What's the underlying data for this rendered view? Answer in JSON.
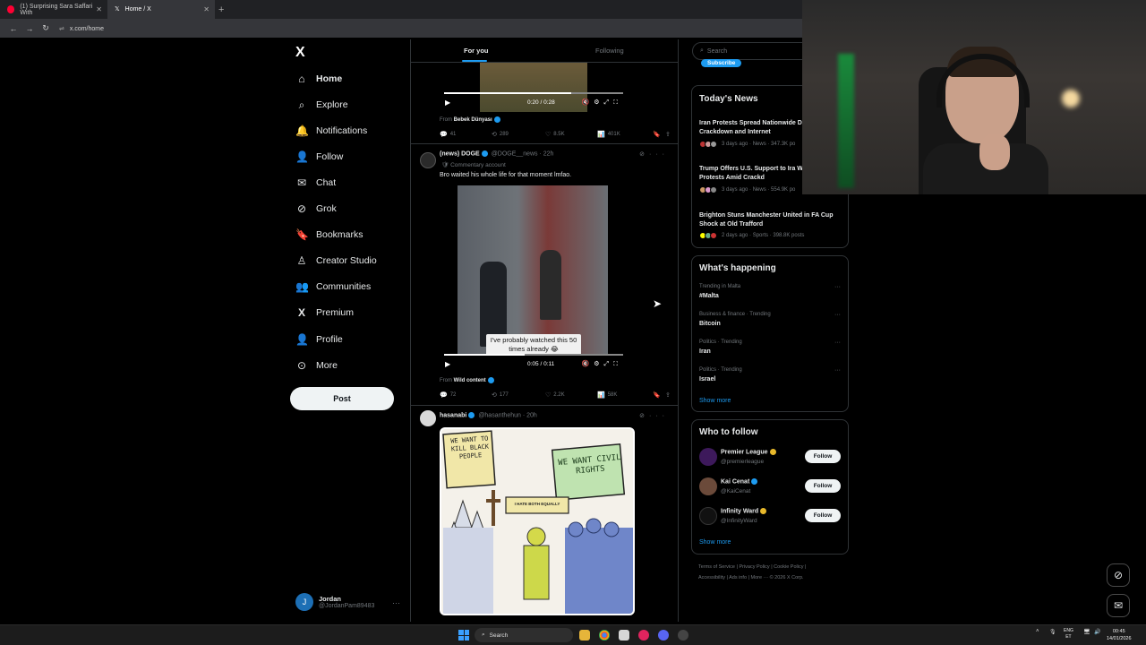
{
  "browser": {
    "tabs": [
      {
        "label": "(1) Surprising Sara Saffari With",
        "favicon_color": "#ff0033"
      },
      {
        "label": "Home / X",
        "favicon_color": "#ffffff"
      }
    ],
    "url": "x.com/home"
  },
  "nav": {
    "logo": "X",
    "items": [
      {
        "label": "Home",
        "icon": "⌂",
        "name": "home"
      },
      {
        "label": "Explore",
        "icon": "⌕",
        "name": "explore"
      },
      {
        "label": "Notifications",
        "icon": "🔔",
        "name": "notifications"
      },
      {
        "label": "Follow",
        "icon": "👤",
        "name": "follow"
      },
      {
        "label": "Chat",
        "icon": "✉",
        "name": "chat"
      },
      {
        "label": "Grok",
        "icon": "⊘",
        "name": "grok"
      },
      {
        "label": "Bookmarks",
        "icon": "🔖",
        "name": "bookmarks"
      },
      {
        "label": "Creator Studio",
        "icon": "♙",
        "name": "creator-studio"
      },
      {
        "label": "Communities",
        "icon": "👥",
        "name": "communities"
      },
      {
        "label": "Premium",
        "icon": "X",
        "name": "premium"
      },
      {
        "label": "Profile",
        "icon": "👤",
        "name": "profile"
      },
      {
        "label": "More",
        "icon": "⊙",
        "name": "more"
      }
    ],
    "post_label": "Post",
    "account": {
      "initial": "J",
      "name": "Jordan",
      "handle": "@JordanPam89483"
    }
  },
  "feed": {
    "tabs": {
      "for_you": "For you",
      "following": "Following"
    },
    "post1": {
      "time": "0:20 / 0:28",
      "progress": 0.71,
      "from_label": "From",
      "from_name": "Bebek Dünyası",
      "replies": "41",
      "reposts": "289",
      "likes": "8.5K",
      "views": "401K"
    },
    "post2": {
      "name": "(news) DOGE",
      "handle": "@DOGE__news · 22h",
      "commentary": "Commentary account",
      "text": "Bro waited his whole life for that moment lmfao.",
      "caption": "I've probably watched this 50 times already 😂",
      "time": "0:05 / 0:11",
      "progress": 0.45,
      "from_label": "From",
      "from_name": "Wild content",
      "replies": "72",
      "reposts": "177",
      "likes": "2.2K",
      "views": "58K"
    },
    "post3": {
      "name": "hasanabi",
      "handle": "@hasanthehun · 20h",
      "sign_left": "WE WANT TO KILL BLACK PEOPLE",
      "sign_right": "WE WANT CIVIL RIGHTS",
      "sign_center": "I HATE BOTH EQUALLY"
    }
  },
  "right": {
    "search_placeholder": "Search",
    "subscribe": "Subscribe",
    "news": {
      "title": "Today's News",
      "items": [
        {
          "title": "Iran Protests Spread Nationwide Deadly Crackdown and Internet",
          "meta": "3 days ago · News · 347.3K po"
        },
        {
          "title": "Trump Offers U.S. Support to Ira Weeklong Protests Amid Crackd",
          "meta": "3 days ago · News · 554.9K po"
        },
        {
          "title": "Brighton Stuns Manchester United in FA Cup Shock at Old Trafford",
          "meta": "2 days ago · Sports · 398.8K posts"
        }
      ]
    },
    "happening": {
      "title": "What's happening",
      "items": [
        {
          "cat": "Trending in Malta",
          "name": "#Malta"
        },
        {
          "cat": "Business & finance · Trending",
          "name": "Bitcoin"
        },
        {
          "cat": "Politics · Trending",
          "name": "Iran"
        },
        {
          "cat": "Politics · Trending",
          "name": "Israel"
        }
      ],
      "show_more": "Show more"
    },
    "who_to_follow": {
      "title": "Who to follow",
      "users": [
        {
          "name": "Premier League",
          "handle": "@premierleague",
          "badge": "gold",
          "color": "#3d195b"
        },
        {
          "name": "Kai Cenat",
          "handle": "@KaiCenat",
          "badge": "blue",
          "color": "#6b4a3a"
        },
        {
          "name": "Infinity Ward",
          "handle": "@InfinityWard",
          "badge": "gold",
          "color": "#111111"
        }
      ],
      "follow_label": "Follow",
      "show_more": "Show more"
    },
    "footer": {
      "line1": "Terms of Service  |  Privacy Policy  |  Cookie Policy  |",
      "line2": "Accessibility  |  Ads info  |  More ···  © 2026 X Corp."
    }
  },
  "taskbar": {
    "search": "Search",
    "lang_top": "ENG",
    "lang_bottom": "ET",
    "time": "00:45",
    "date": "14/01/2026"
  }
}
